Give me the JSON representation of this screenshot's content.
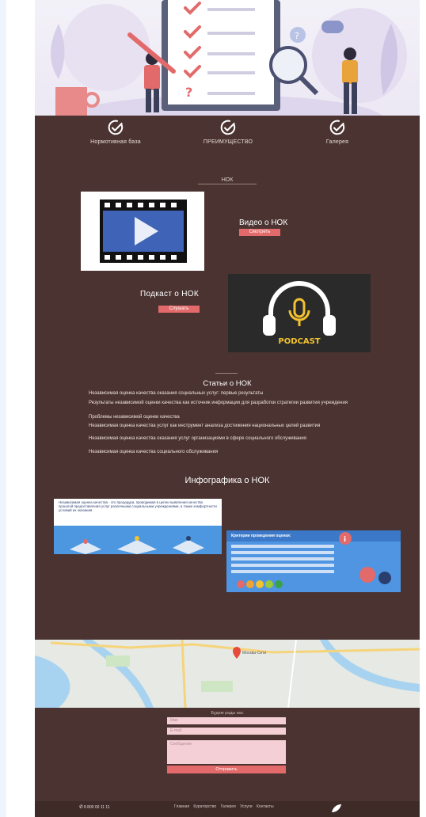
{
  "features": [
    {
      "label": "Нормотивная база",
      "icon": "check-circle-icon"
    },
    {
      "label": "ПРЕИМУЩЕСТВО",
      "icon": "check-circle-icon"
    },
    {
      "label": "Галерея",
      "icon": "check-circle-icon"
    }
  ],
  "nok_heading": "НОК",
  "video": {
    "title": "Видео о НОК",
    "button": "Смотреть"
  },
  "podcast": {
    "title": "Подкаст о НОК",
    "button": "Слушать",
    "badge": "PODCAST"
  },
  "articles": {
    "title": "Статьи о НОК",
    "items": [
      "Независимая оценка качества оказания социальных услуг: первые результаты",
      "Результаты независимой оценки качества как источник информации для разработки стратегии развития учреждения",
      "Проблемы независимой оценки качества",
      "Независимая оценка качества услуг как инструмент анализа достижения национальных целей развития",
      " Независимая оценка качества оказания услуг организациями в сфере социального обслуживания",
      "Независимая оценка качества социального обслуживания"
    ]
  },
  "infographics": {
    "title": "Инфографика о НОК",
    "card1_text": "Независимая оценка качества - это процедура, проводимая в целях выявления качества прошлой предоставления услуг различными социальными учреждениями, а также комфортности условий их оказания.",
    "card2_title": "Критерии проведения оценки:"
  },
  "map": {
    "label": "Москва-Сити"
  },
  "form": {
    "title": "Будем рады вас",
    "name_placeholder": "Имя",
    "email_placeholder": "E-mail",
    "message_placeholder": "Сообщение",
    "submit": "Отправить"
  },
  "footer": {
    "phone": "8 800 00 11 11",
    "nav": [
      "Главная",
      "Кураторство",
      "Галерея",
      "Услуги",
      "Контакты"
    ]
  },
  "colors": {
    "background": "#4a3330",
    "accent": "#e36a6a",
    "field": "#f4cfd6"
  }
}
